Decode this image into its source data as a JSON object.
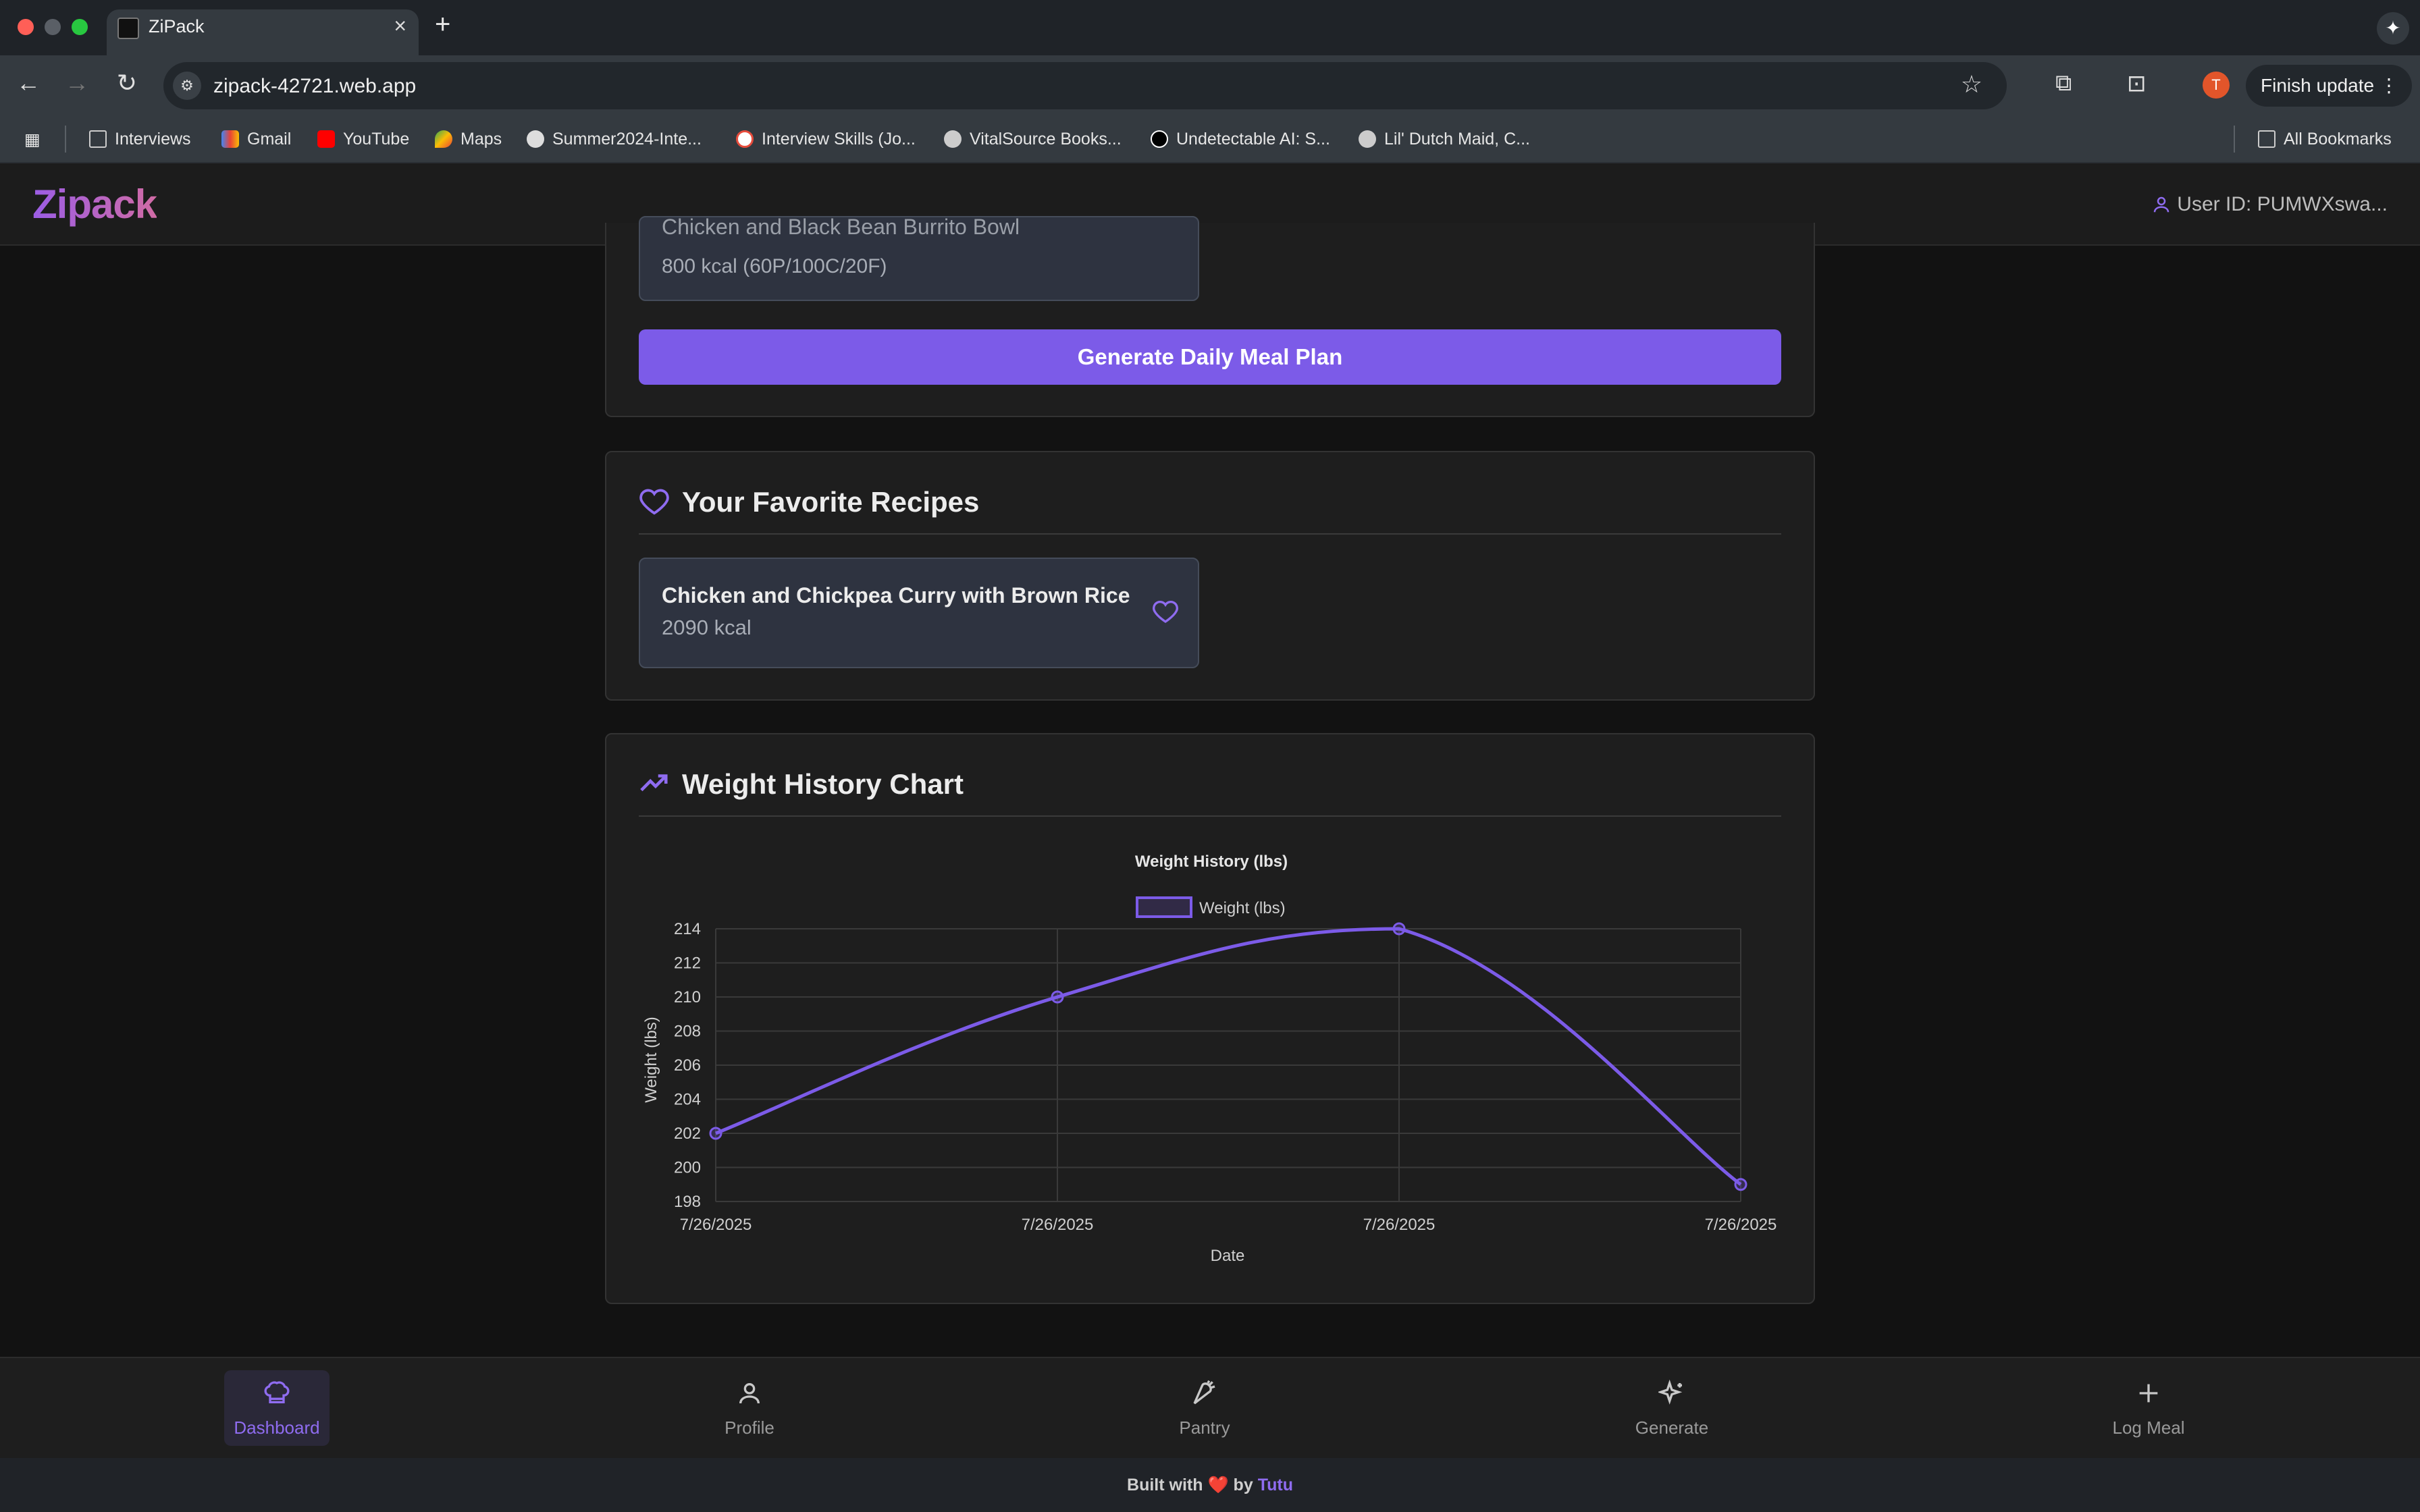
{
  "browser": {
    "tab_title": "ZiPack",
    "url": "zipack-42721.web.app",
    "finish_update": "Finish update",
    "profile_initial": "T",
    "bookmarks": [
      {
        "label": "Interviews",
        "icon": "folder-icon"
      },
      {
        "label": "Gmail",
        "icon": "gmail-icon"
      },
      {
        "label": "YouTube",
        "icon": "youtube-icon"
      },
      {
        "label": "Maps",
        "icon": "maps-icon"
      },
      {
        "label": "Summer2024-Inte...",
        "icon": "github-icon"
      },
      {
        "label": "Interview Skills (Jo...",
        "icon": "site-icon"
      },
      {
        "label": "VitalSource Books...",
        "icon": "globe-icon"
      },
      {
        "label": "Undetectable AI: S...",
        "icon": "site-icon"
      },
      {
        "label": "Lil' Dutch Maid, C...",
        "icon": "globe-icon"
      }
    ],
    "all_bookmarks": "All Bookmarks"
  },
  "app": {
    "logo": "Zipack",
    "user_id": "User ID: PUMWXswa..."
  },
  "meal_plan": {
    "partial_meal_name": "Chicken and Black Bean Burrito Bowl",
    "partial_meal_kcal": "800 kcal (60P/100C/20F)",
    "generate_button": "Generate Daily Meal Plan"
  },
  "favorites": {
    "title": "Your Favorite Recipes",
    "items": [
      {
        "name": "Chicken and Chickpea Curry with Brown Rice",
        "kcal": "2090 kcal"
      }
    ]
  },
  "weight_chart": {
    "section_title": "Weight History Chart"
  },
  "chart_data": {
    "type": "line",
    "title": "Weight History (lbs)",
    "xlabel": "Date",
    "ylabel": "Weight (lbs)",
    "categories": [
      "7/26/2025",
      "7/26/2025",
      "7/26/2025",
      "7/26/2025"
    ],
    "series": [
      {
        "name": "Weight (lbs)",
        "values": [
          202,
          210,
          214,
          199
        ],
        "color": "#7c5be8"
      }
    ],
    "ylim": [
      198,
      214
    ],
    "yticks": [
      198,
      200,
      202,
      204,
      206,
      208,
      210,
      212,
      214
    ],
    "grid": true,
    "legend": "top-center",
    "smooth": true
  },
  "bottom_nav": {
    "items": [
      {
        "label": "Dashboard",
        "icon": "chef-hat-icon",
        "active": true
      },
      {
        "label": "Profile",
        "icon": "user-icon",
        "active": false
      },
      {
        "label": "Pantry",
        "icon": "carrot-icon",
        "active": false
      },
      {
        "label": "Generate",
        "icon": "sparkles-icon",
        "active": false
      },
      {
        "label": "Log Meal",
        "icon": "plus-icon",
        "active": false
      }
    ]
  },
  "footer": {
    "prefix": "Built with",
    "heart": "❤️",
    "by": "by",
    "author": "Tutu"
  },
  "colors": {
    "accent": "#7c5be8",
    "background": "#121212",
    "card": "#1e1e1e"
  }
}
